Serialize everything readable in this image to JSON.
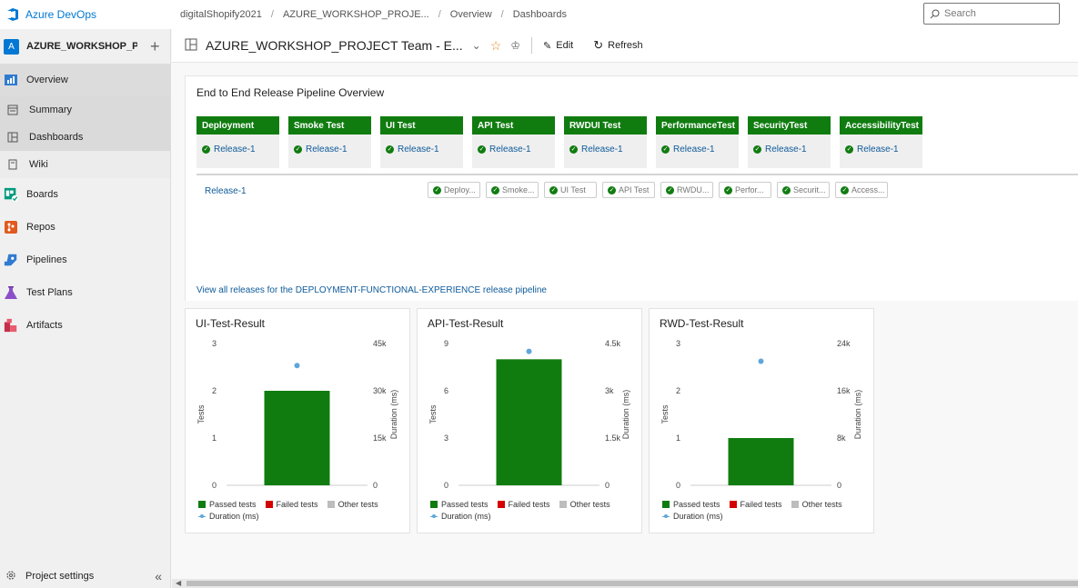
{
  "app": {
    "name": "Azure DevOps",
    "brand_color": "#0078d4"
  },
  "breadcrumbs": [
    "digitalShopify2021",
    "AZURE_WORKSHOP_PROJE...",
    "Overview",
    "Dashboards"
  ],
  "search": {
    "placeholder": "Search",
    "value": ""
  },
  "sidebar": {
    "project_initial": "A",
    "project_name": "AZURE_WORKSHOP_P...",
    "items": [
      {
        "label": "Overview",
        "icon": "overview-icon"
      },
      {
        "label": "Summary",
        "icon": "summary-icon"
      },
      {
        "label": "Dashboards",
        "icon": "dashboards-icon"
      },
      {
        "label": "Wiki",
        "icon": "wiki-icon"
      },
      {
        "label": "Boards",
        "icon": "boards-icon"
      },
      {
        "label": "Repos",
        "icon": "repos-icon"
      },
      {
        "label": "Pipelines",
        "icon": "pipelines-icon"
      },
      {
        "label": "Test Plans",
        "icon": "test-plans-icon"
      },
      {
        "label": "Artifacts",
        "icon": "artifacts-icon"
      }
    ],
    "settings_label": "Project settings"
  },
  "header": {
    "title": "AZURE_WORKSHOP_PROJECT Team - E...",
    "edit_label": "Edit",
    "refresh_label": "Refresh"
  },
  "release_widget": {
    "title": "End to End Release Pipeline Overview",
    "environments": [
      {
        "name": "Deployment",
        "release": "Release-1"
      },
      {
        "name": "Smoke Test",
        "release": "Release-1"
      },
      {
        "name": "UI Test",
        "release": "Release-1"
      },
      {
        "name": "API Test",
        "release": "Release-1"
      },
      {
        "name": "RWDUI Test",
        "release": "Release-1"
      },
      {
        "name": "PerformanceTest",
        "release": "Release-1"
      },
      {
        "name": "SecurityTest",
        "release": "Release-1"
      },
      {
        "name": "AccessibilityTest",
        "release": "Release-1"
      }
    ],
    "release_row_label": "Release-1",
    "stage_pills": [
      "Deploy...",
      "Smoke...",
      "UI Test",
      "API Test",
      "RWDU...",
      "Perfor...",
      "Securit...",
      "Access..."
    ],
    "view_all_link": "View all releases for the DEPLOYMENT-FUNCTIONAL-EXPERIENCE release pipeline",
    "status_color": "#107c10"
  },
  "legend": {
    "passed": "Passed tests",
    "failed": "Failed tests",
    "other": "Other tests",
    "duration": "Duration (ms)"
  },
  "colors": {
    "passed": "#107c10",
    "failed": "#d40000",
    "other": "#bdbdbd",
    "duration": "#5ea6d9"
  },
  "chart_data": [
    {
      "type": "bar",
      "title": "UI-Test-Result",
      "ylabel": "Tests",
      "y2label": "Duration (ms)",
      "ylim": [
        0,
        3
      ],
      "yticks": [
        "0",
        "1",
        "2",
        "3"
      ],
      "y2lim": [
        0,
        45000
      ],
      "y2ticks": [
        "0",
        "15k",
        "30k",
        "45k"
      ],
      "series": [
        {
          "name": "Passed tests",
          "values": [
            2
          ]
        },
        {
          "name": "Failed tests",
          "values": [
            0
          ]
        },
        {
          "name": "Other tests",
          "values": [
            0
          ]
        }
      ],
      "duration": [
        38000
      ],
      "grid": false,
      "legend": "bottom"
    },
    {
      "type": "bar",
      "title": "API-Test-Result",
      "ylabel": "Tests",
      "y2label": "Duration (ms)",
      "ylim": [
        0,
        9
      ],
      "yticks": [
        "0",
        "3",
        "6",
        "9"
      ],
      "y2lim": [
        0,
        4500
      ],
      "y2ticks": [
        "0",
        "1.5k",
        "3k",
        "4.5k"
      ],
      "series": [
        {
          "name": "Passed tests",
          "values": [
            8
          ]
        },
        {
          "name": "Failed tests",
          "values": [
            0
          ]
        },
        {
          "name": "Other tests",
          "values": [
            0
          ]
        }
      ],
      "duration": [
        4250
      ],
      "grid": false,
      "legend": "bottom"
    },
    {
      "type": "bar",
      "title": "RWD-Test-Result",
      "ylabel": "Tests",
      "y2label": "Duration (ms)",
      "ylim": [
        0,
        3
      ],
      "yticks": [
        "0",
        "1",
        "2",
        "3"
      ],
      "y2lim": [
        0,
        24000
      ],
      "y2ticks": [
        "0",
        "8k",
        "16k",
        "24k"
      ],
      "series": [
        {
          "name": "Passed tests",
          "values": [
            1
          ]
        },
        {
          "name": "Failed tests",
          "values": [
            0
          ]
        },
        {
          "name": "Other tests",
          "values": [
            0
          ]
        }
      ],
      "duration": [
        21000
      ],
      "grid": false,
      "legend": "bottom"
    }
  ]
}
